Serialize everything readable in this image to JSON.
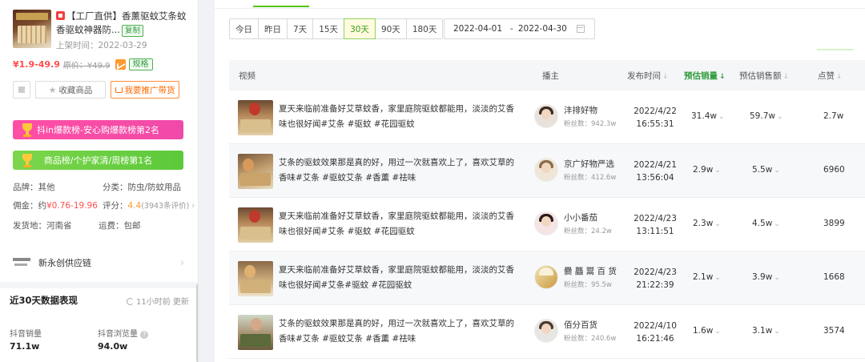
{
  "product": {
    "title_bracket": "【工厂直供】",
    "title_rest": "香薰驱蚊艾条蚊香驱蚊神器防...",
    "copy_label": "复制",
    "listed_prefix": "上架时间：",
    "listed_date": "2022-03-29",
    "price": "¥1.9-49.9",
    "orig_price": "原价：¥49.9",
    "spec_label": "规格",
    "fav_label": "收藏商品",
    "promote_label": "我要推广带货",
    "rank1": "抖in爆款榜-安心购爆款榜第2名",
    "rank2": "商品榜/个护家清/周榜第1名",
    "brand_k": "品牌：",
    "brand_v": "其他",
    "category_k": "分类：",
    "category_v": "防虫/防蚊用品",
    "commission_k": "佣金：",
    "commission_pre": "约",
    "commission_v": "¥0.76-19.96",
    "rating_k": "评分：",
    "rating_v": "4.4",
    "rating_count": "(3943条评价)",
    "ship_from_k": "发货地：",
    "ship_from_v": "河南省",
    "shipping_k": "运费：",
    "shipping_v": "包邮",
    "supplier": "新永创供应链"
  },
  "stats": {
    "section_title": "近30天数据表现",
    "updated": "11小时前 更新",
    "sales_label": "抖音销量",
    "sales_value": "71.1w",
    "views_label": "抖音浏览量",
    "views_value": "94.0w"
  },
  "filters": {
    "ranges": [
      "今日",
      "昨日",
      "7天",
      "15天",
      "30天",
      "90天",
      "180天"
    ],
    "active_range": "30天",
    "date_start": "2022-04-01",
    "date_sep": "-",
    "date_end": "2022-04-30"
  },
  "table": {
    "columns": {
      "video": "视频",
      "anchor": "播主",
      "publish_time": "发布时间",
      "est_sales": "预估销量",
      "est_revenue": "预估销售额",
      "likes": "点赞"
    },
    "rows": [
      {
        "text": "夏天来临前准备好艾草蚊香，家里庭院驱蚊都能用，淡淡的艾香味也很好闻#艾条 #驱蚊 #花园驱蚊",
        "anchor": "沣排好物",
        "fans": "粉丝数：942.3w",
        "date": "2022/4/22",
        "time": "16:55:31",
        "sales": "31.4w",
        "revenue": "59.7w",
        "likes": "2.7w"
      },
      {
        "text": "艾条的驱蚊效果那是真的好，用过一次就喜欢上了，喜欢艾草的香味#艾条 #驱蚊艾条 #香薰 #祛味",
        "anchor": "京广好物严选",
        "fans": "粉丝数：412.6w",
        "date": "2022/4/21",
        "time": "13:56:04",
        "sales": "2.9w",
        "revenue": "5.5w",
        "likes": "6960"
      },
      {
        "text": "夏天来临前准备好艾草蚊香，家里庭院驱蚊都能用，淡淡的艾香味也很好闻#艾条 #驱蚊 #花园驱蚊",
        "anchor": "小小番茄",
        "fans": "粉丝数：24.2w",
        "date": "2022/4/23",
        "time": "13:11:51",
        "sales": "2.3w",
        "revenue": "4.5w",
        "likes": "3899"
      },
      {
        "text": "夏天来临前准备好艾草蚊香，家里庭院驱蚊都能用，淡淡的艾香味也很好闻#艾条#驱蚊 #花园驱蚊",
        "anchor": "爨 龘 鬻 百 货",
        "fans": "粉丝数：95.5w",
        "date": "2022/4/23",
        "time": "21:22:39",
        "sales": "2.1w",
        "revenue": "3.9w",
        "likes": "1668"
      },
      {
        "text": "艾条的驱蚊效果那是真的好，用过一次就喜欢上了，喜欢艾草的香味#艾条 #驱蚊艾条 #香薰 #祛味",
        "anchor": "佰分百货",
        "fans": "粉丝数：240.6w",
        "date": "2022/4/10",
        "time": "16:21:46",
        "sales": "1.6w",
        "revenue": "3.1w",
        "likes": "3574"
      }
    ]
  },
  "colors": {
    "accent_green": "#2e9b3c",
    "price_red": "#ff4d4f",
    "rank_pink": "#f04aa8",
    "rank_green": "#5cc93a",
    "promo_orange": "#ff6a00"
  }
}
